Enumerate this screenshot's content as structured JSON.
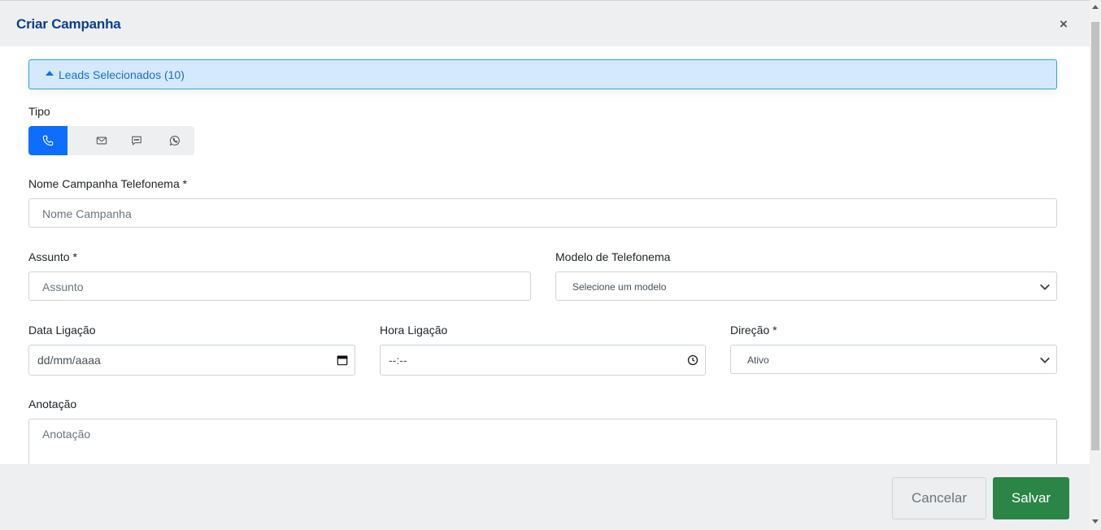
{
  "modal": {
    "title": "Criar Campanha",
    "close_label": "×"
  },
  "leads": {
    "label": "Leads Selecionados (10)"
  },
  "tipo": {
    "label": "Tipo",
    "options": [
      {
        "icon": "phone-icon",
        "active": true
      },
      {
        "icon": "mail-icon",
        "active": false
      },
      {
        "icon": "message-icon",
        "active": false
      },
      {
        "icon": "whatsapp-icon",
        "active": false
      }
    ]
  },
  "form": {
    "nome_label": "Nome Campanha Telefonema *",
    "nome_placeholder": "Nome Campanha",
    "assunto_label": "Assunto *",
    "assunto_placeholder": "Assunto",
    "modelo_label": "Modelo de Telefonema",
    "modelo_value": "Selecione um modelo",
    "data_label": "Data Ligação",
    "data_value": "dd/mm/aaaa",
    "hora_label": "Hora Ligação",
    "hora_value": "--:--",
    "direcao_label": "Direção *",
    "direcao_value": "Ativo",
    "anotacao_label": "Anotação",
    "anotacao_placeholder": "Anotação"
  },
  "footer": {
    "cancel_label": "Cancelar",
    "save_label": "Salvar"
  },
  "colors": {
    "title": "#0d3f86",
    "active_type": "#0d6efd",
    "save_button": "#2a8546",
    "leads_panel_bg": "#d4e9fb"
  }
}
